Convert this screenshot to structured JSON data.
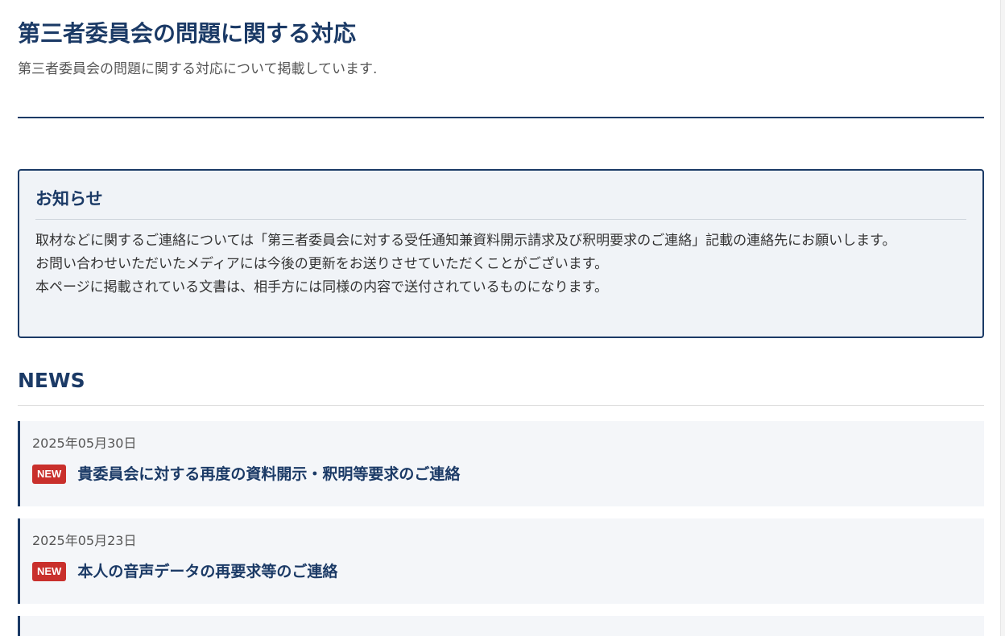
{
  "page": {
    "title": "第三者委員会の問題に関する対応",
    "description": "第三者委員会の問題に関する対応について掲載しています."
  },
  "notice": {
    "heading": "お知らせ",
    "lines": [
      "取材などに関するご連絡については「第三者委員会に対する受任通知兼資料開示請求及び釈明要求のご連絡」記載の連絡先にお願いします。",
      "お問い合わせいただいたメディアには今後の更新をお送りさせていただくことがございます。",
      "本ページに掲載されている文書は、相手方には同様の内容で送付されているものになります。"
    ]
  },
  "news": {
    "heading": "NEWS",
    "items": [
      {
        "date": "2025年05月30日",
        "badge": "NEW",
        "title": "貴委員会に対する再度の資料開示・釈明等要求のご連絡"
      },
      {
        "date": "2025年05月23日",
        "badge": "NEW",
        "title": "本人の音声データの再要求等のご連絡"
      }
    ]
  },
  "colors": {
    "accent": "#1b3a66",
    "badge": "#c9302c",
    "panel_bg": "#f0f3f7",
    "item_bg": "#f4f6f9"
  }
}
